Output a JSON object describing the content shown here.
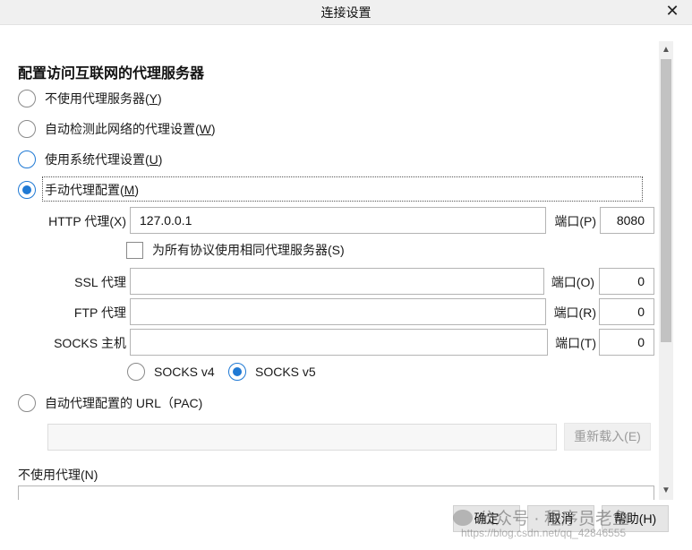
{
  "window": {
    "title": "连接设置"
  },
  "heading": "配置访问互联网的代理服务器",
  "proxy_modes": [
    {
      "label": "不使用代理服务器",
      "key": "Y",
      "checked": false
    },
    {
      "label": "自动检测此网络的代理设置",
      "key": "W",
      "checked": false
    },
    {
      "label": "使用系统代理设置",
      "key": "U",
      "checked": false
    },
    {
      "label": "手动代理配置",
      "key": "M",
      "checked": true
    }
  ],
  "manual": {
    "http_label": "HTTP 代理(X)",
    "http_value": "127.0.0.1",
    "http_port_label": "端口(P)",
    "http_port": "8080",
    "same_proxy_label": "为所有协议使用相同代理服务器(S)",
    "ssl_label": "SSL 代理",
    "ssl_value": "",
    "ssl_port_label": "端口(O)",
    "ssl_port": "0",
    "ftp_label": "FTP 代理",
    "ftp_value": "",
    "ftp_port_label": "端口(R)",
    "ftp_port": "0",
    "socks_label": "SOCKS 主机",
    "socks_value": "",
    "socks_port_label": "端口(T)",
    "socks_port": "0",
    "socks_v4": "SOCKS v4",
    "socks_v5": "SOCKS v5",
    "socks_selected": "v5"
  },
  "pac": {
    "label": "自动代理配置的 URL（PAC)",
    "url": "",
    "reload_label": "重新载入(E)"
  },
  "no_proxy": {
    "label": "不使用代理(N)",
    "value": ""
  },
  "footer": {
    "ok": "确定",
    "cancel": "取消",
    "help": "帮助(H)"
  },
  "watermark": {
    "line1": "公众号 · 程序员老鱼",
    "line2": "https://blog.csdn.net/qq_42846555"
  },
  "colors": {
    "accent": "#1f79d4",
    "disabled_text": "#9a9a9a"
  }
}
